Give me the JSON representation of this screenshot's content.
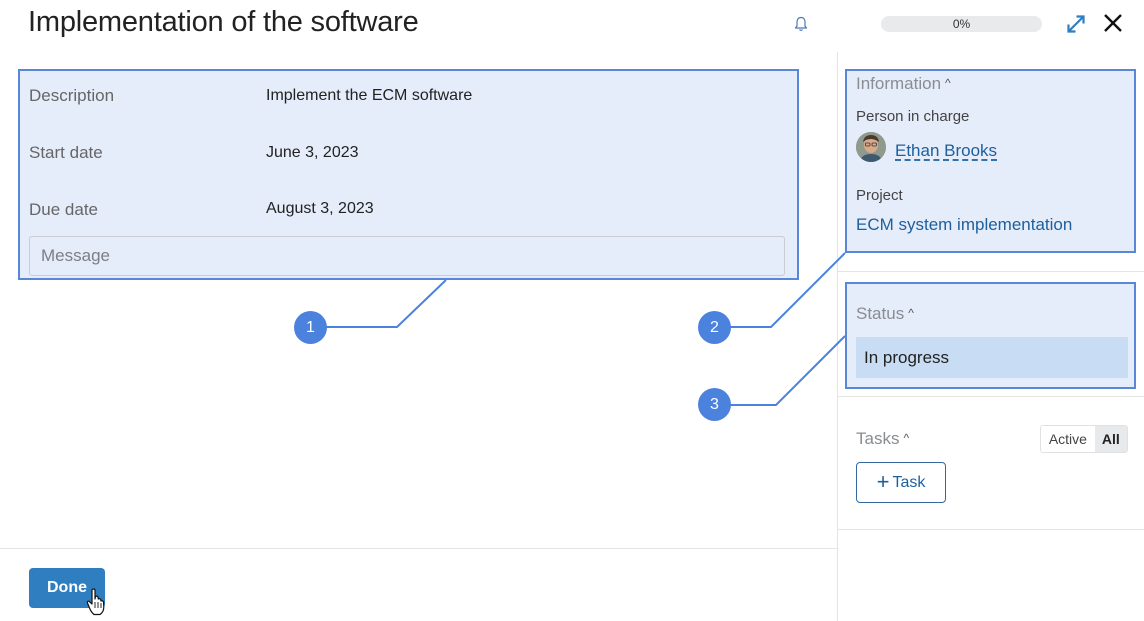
{
  "header": {
    "title": "Implementation of the software",
    "progress_text": "0%",
    "progress_value": 0
  },
  "details": {
    "fields": [
      {
        "label": "Description",
        "value": "Implement the ECM software"
      },
      {
        "label": "Start date",
        "value": "June 3, 2023"
      },
      {
        "label": "Due date",
        "value": "August 3, 2023"
      }
    ],
    "message_placeholder": "Message"
  },
  "sidebar": {
    "information": {
      "title": "Information",
      "person_label": "Person in charge",
      "person_name": "Ethan Brooks",
      "project_label": "Project",
      "project_name": "ECM system implementation"
    },
    "status": {
      "title": "Status",
      "value": "In progress"
    },
    "tasks": {
      "title": "Tasks",
      "filter_active": "Active",
      "filter_all": "All",
      "add_label": "Task"
    }
  },
  "footer": {
    "done_label": "Done"
  },
  "callouts": [
    "1",
    "2",
    "3"
  ],
  "colors": {
    "highlight_fill": "#e5ecfa",
    "highlight_border": "#5a86d9",
    "marker": "#4b82dd",
    "link": "#1e5f9c",
    "primary_button": "#2f7ec0",
    "status_fill": "#c8dcf4"
  },
  "icons": [
    "bell-icon",
    "expand-icon",
    "close-icon",
    "chevron-up-icon",
    "plus-icon",
    "hand-cursor-icon"
  ]
}
